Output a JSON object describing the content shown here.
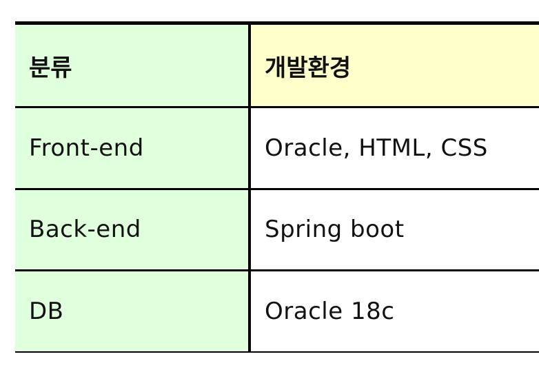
{
  "table": {
    "headers": {
      "category": "분류",
      "environment": "개발환경"
    },
    "rows": [
      {
        "category": "Front-end",
        "environment": "Oracle, HTML, CSS"
      },
      {
        "category": "Back-end",
        "environment": "Spring boot"
      },
      {
        "category": "DB",
        "environment": "Oracle 18c"
      }
    ]
  },
  "colors": {
    "header_bg": "#ffffcc",
    "category_bg": "#e0ffdc",
    "border": "#000000"
  }
}
